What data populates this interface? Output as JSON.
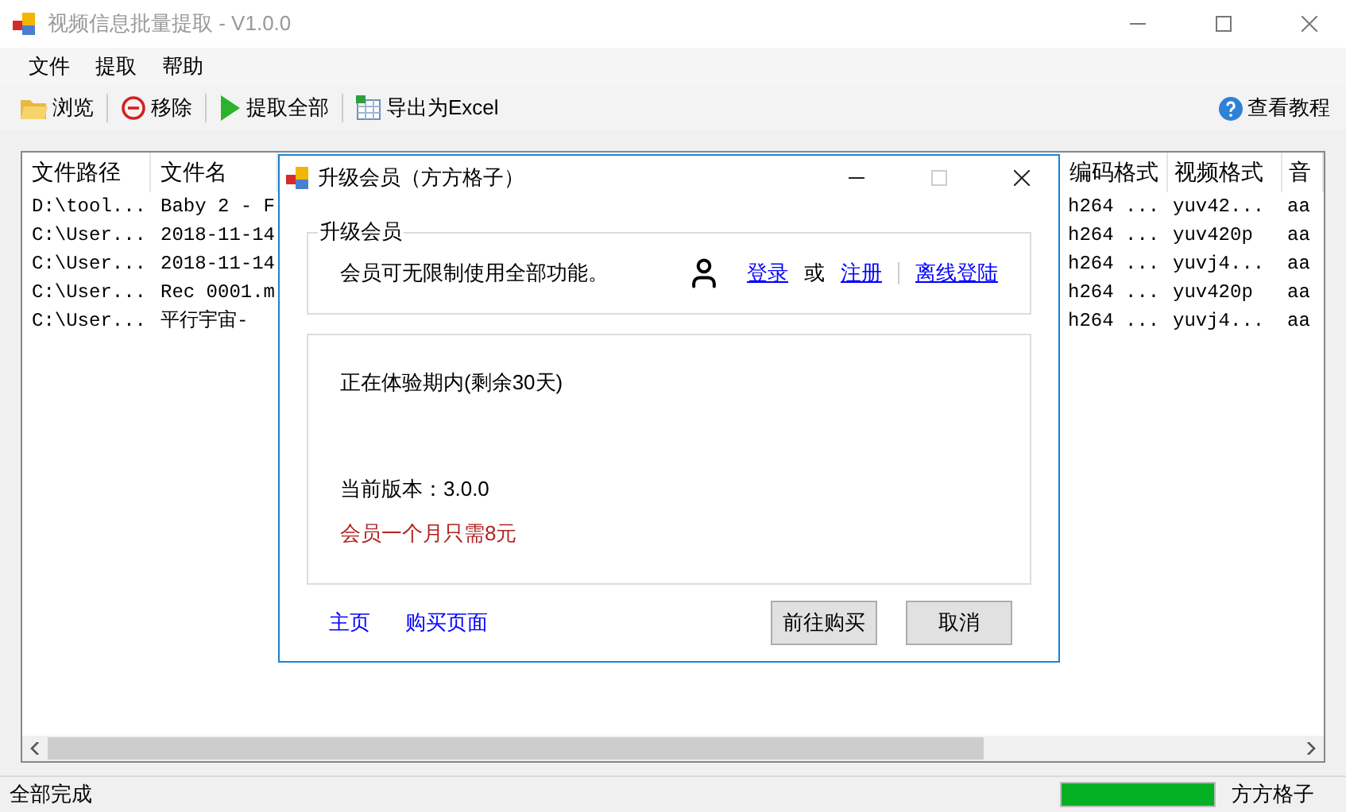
{
  "window": {
    "title": "视频信息批量提取 - V1.0.0"
  },
  "menu": [
    "文件",
    "提取",
    "帮助"
  ],
  "toolbar": [
    {
      "kind": "folder",
      "label": "浏览"
    },
    {
      "kind": "remove",
      "label": "移除"
    },
    {
      "kind": "play",
      "label": "提取全部"
    },
    {
      "kind": "sheet",
      "label": "导出为Excel"
    }
  ],
  "help_button": "查看教程",
  "table": {
    "columns_left": [
      "文件路径",
      "文件名"
    ],
    "columns_right": [
      "编码格式",
      "视频格式",
      "音"
    ],
    "rows": [
      {
        "left": [
          "D:\\tool...",
          "Baby 2 - F"
        ],
        "right": [
          "h264 ...",
          "yuv42...",
          "aa"
        ]
      },
      {
        "left": [
          "C:\\User...",
          "2018-11-14"
        ],
        "right": [
          "h264 ...",
          "yuv420p",
          "aa"
        ]
      },
      {
        "left": [
          "C:\\User...",
          "2018-11-14"
        ],
        "right": [
          "h264 ...",
          "yuvj4...",
          "aa"
        ]
      },
      {
        "left": [
          "C:\\User...",
          "Rec 0001.m"
        ],
        "right": [
          "h264 ...",
          "yuv420p",
          "aa"
        ]
      },
      {
        "left": [
          "C:\\User...",
          "平行宇宙-"
        ],
        "right": [
          "h264 ...",
          "yuvj4...",
          "aa"
        ]
      }
    ]
  },
  "dialog": {
    "title": "升级会员（方方格子）",
    "group_title": "升级会员",
    "intro": "会员可无限制使用全部功能。",
    "account_links": [
      {
        "kind": "link",
        "label": "登录"
      },
      {
        "kind": "text",
        "label": "或"
      },
      {
        "kind": "link",
        "label": "注册"
      },
      {
        "kind": "divider"
      },
      {
        "kind": "link",
        "label": "离线登陆"
      }
    ],
    "trial": "正在体验期内(剩余30天)",
    "version": "当前版本：3.0.0",
    "price": "会员一个月只需8元",
    "footer_links": [
      "主页",
      "购买页面"
    ],
    "buttons": [
      "前往购买",
      "取消"
    ]
  },
  "status_bar": {
    "text": "全部完成",
    "progress": {
      "level": 1
    },
    "right_text": "方方格子"
  }
}
